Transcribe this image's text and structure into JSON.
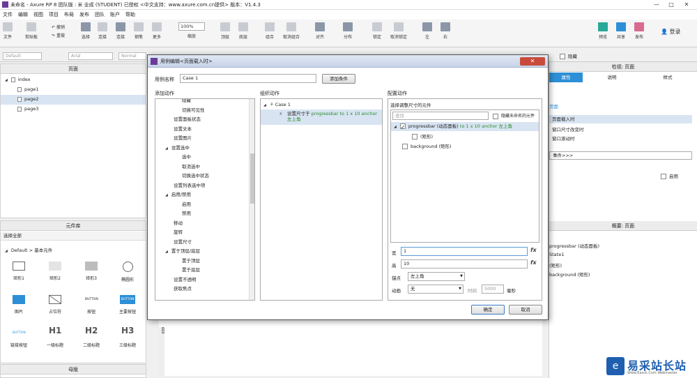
{
  "window": {
    "title": "未命名 - Axure RP 8 团队版 : 米 业成 (STUDENT) 已授权    <中文支持：www.axure.com.cn提供> 版本：V1.4.3",
    "controls": [
      "—",
      "□",
      "✕"
    ]
  },
  "menu": [
    "文件",
    "编辑",
    "视图",
    "项目",
    "布局",
    "发布",
    "团队",
    "账户",
    "帮助"
  ],
  "toolbar": {
    "file": "文件",
    "clipboard": "剪贴板",
    "undo": "撤销",
    "redo": "重做",
    "select": "选择",
    "connect": "连接",
    "pen": "钢笔",
    "more": "更多",
    "zoom_value": "100%",
    "zoom_label": "缩放",
    "top": "顶层",
    "bottom": "底层",
    "group": "组合",
    "ungroup": "取消组合",
    "align": "对齐",
    "distribute": "分布",
    "lock": "锁定",
    "unlock": "取消锁定",
    "left": "左",
    "right": "右",
    "preview": "预览",
    "share": "共享",
    "publish": "发布",
    "login": "登录"
  },
  "format_bar": {
    "style": "Default",
    "font": "Arial",
    "weight": "Normal",
    "hide": "隐藏"
  },
  "pages_panel": {
    "title": "页面",
    "items": [
      {
        "label": "index",
        "level": 0
      },
      {
        "label": "page1",
        "level": 1
      },
      {
        "label": "page2",
        "level": 1,
        "selected": true
      },
      {
        "label": "page3",
        "level": 1
      }
    ]
  },
  "library_panel": {
    "title": "元件库",
    "select_all": "选择全部",
    "category": "Default > 基本元件",
    "widgets": [
      "矩形1",
      "矩形2",
      "矩形3",
      "椭圆形",
      "图片",
      "占位符",
      "按钮",
      "主要按钮",
      "链接按钮",
      "一级标题",
      "二级标题",
      "三级标题"
    ],
    "button_text": "BUTTON",
    "h1": "H1",
    "h2": "H2",
    "h3": "H3"
  },
  "masters_panel": {
    "title": "母版"
  },
  "right_panel": {
    "inspector_title": "检视: 页面",
    "tabs": [
      "属性",
      "说明",
      "样式"
    ],
    "events_heading": "页面",
    "events": [
      "页面载入时",
      "窗口尺寸改变时",
      "窗口滚动时"
    ],
    "more_events": "事件>>>",
    "enable": "启用",
    "outline_title": "概要: 页面",
    "outline_items": [
      "progressbar (动态面板)",
      "State1",
      "(矩形)",
      "background (矩形)"
    ]
  },
  "canvas": {
    "ruler_mark": "600"
  },
  "dialog": {
    "title": "用例编辑<页面载入时>",
    "case_name_label": "用例名称",
    "case_name_value": "Case 1",
    "add_condition": "添加条件",
    "add_action_header": "添加动作",
    "organize_header": "组织动作",
    "configure_header": "配置动作",
    "actions": [
      {
        "label": "隐藏",
        "level": 2
      },
      {
        "label": "切换可见性",
        "level": 2
      },
      {
        "label": "设置面板状态",
        "level": 1
      },
      {
        "label": "设置文本",
        "level": 1
      },
      {
        "label": "设置图片",
        "level": 1
      },
      {
        "label": "设置选中",
        "level": 1,
        "caret": true
      },
      {
        "label": "选中",
        "level": 2
      },
      {
        "label": "取消选中",
        "level": 2
      },
      {
        "label": "切换选中状态",
        "level": 2
      },
      {
        "label": "设置列表选中项",
        "level": 1
      },
      {
        "label": "启用/禁用",
        "level": 1,
        "caret": true
      },
      {
        "label": "启用",
        "level": 2
      },
      {
        "label": "禁用",
        "level": 2
      },
      {
        "label": "移动",
        "level": 1
      },
      {
        "label": "旋转",
        "level": 1
      },
      {
        "label": "设置尺寸",
        "level": 1
      },
      {
        "label": "置于顶层/底层",
        "level": 1,
        "caret": true
      },
      {
        "label": "置于顶层",
        "level": 2
      },
      {
        "label": "置于底层",
        "level": 2
      },
      {
        "label": "设置不透明",
        "level": 1
      },
      {
        "label": "获取焦点",
        "level": 1
      }
    ],
    "case_item": "Case 1",
    "case_action_prefix": "设置尺寸于",
    "case_action_detail": "progressbar to 1 x 10 anchor 左上角",
    "select_widget_label": "选择调整尺寸的元件",
    "search_placeholder": "查找",
    "hide_unnamed": "隐藏未命名的元件",
    "widgets": [
      {
        "name": "progressbar (动态面板)",
        "detail": "to 1 x 10 anchor 左上角",
        "checked": true,
        "level": 0
      },
      {
        "name": "(矩形)",
        "detail": "",
        "checked": false,
        "level": 1
      },
      {
        "name": "background (矩形)",
        "detail": "",
        "checked": false,
        "level": 0
      }
    ],
    "width_label": "宽",
    "width_value": "1",
    "height_label": "高",
    "height_value": "10",
    "fx": "fx",
    "anchor_label": "锚点",
    "anchor_value": "左上角",
    "animation_label": "动画",
    "animation_value": "无",
    "time_label": "时间",
    "time_value": "5000",
    "ms_label": "毫秒",
    "ok": "确定",
    "cancel": "取消"
  },
  "watermark": {
    "text": "易采站长站",
    "sub": "Www.Easck.Com Webmaster"
  }
}
